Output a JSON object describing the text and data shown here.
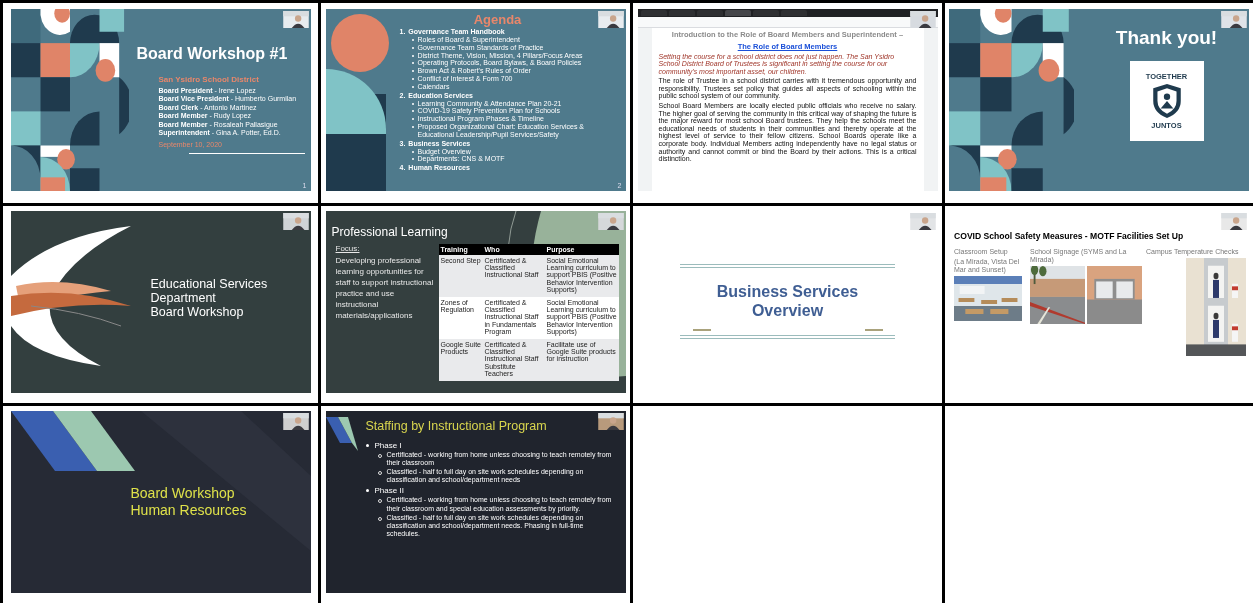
{
  "slides": [
    {
      "kind": "workshop",
      "title": "Board Workshop #1",
      "district": "San Ysidro School District",
      "members": [
        "**Board President** - Irene Lopez",
        "**Board Vice President** - Humberto Gurmilan",
        "**Board Clerk** - Antonio Martinez",
        "**Board Member** - Rudy Lopez",
        "**Board Member** - Rosaleah Pallasigue",
        "**Superintendent** - Gina A. Potter, Ed.D."
      ],
      "date": "September 10, 2020",
      "page": "1"
    },
    {
      "kind": "agenda",
      "title": "Agenda",
      "sections": [
        {
          "number": "1.",
          "heading": "Governance Team Handbook",
          "items": [
            "Roles of Board & Superintendent",
            "Governance Team Standards of Practice",
            "District Theme, Vision, Mission, 4 Pillars/Focus Areas",
            "Operating Protocols, Board Bylaws, & Board Policies",
            "Brown Act & Robert's Rules of Order",
            "Conflict of Interest & Form 700",
            "Calendars"
          ]
        },
        {
          "number": "2.",
          "heading": "Education Services",
          "items": [
            "Learning Community & Attendance Plan 20-21",
            "COVID-19 Safety Prevention Plan for Schools",
            "Instructional Program Phases & Timeline",
            "Proposed Organizational Chart: Education Services & Educational Leadership/Pupil Services/Safety"
          ]
        },
        {
          "number": "3.",
          "heading": "Business Services",
          "items": [
            "Budget Overview",
            "Departments: CNS & MOTF"
          ]
        },
        {
          "number": "4.",
          "heading": "Human Resources"
        }
      ],
      "page": "2"
    },
    {
      "kind": "document",
      "heading": "Introduction to the Role of Board Members and Superintendent –",
      "link": "The Role of Board Members",
      "quote": "Setting the course for a school district does not just happen. The San Ysidro School District Board of Trustees is significant in setting the course for our community's most important asset, our children.",
      "paragraphs": [
        "The role of Trustee in a school district carries with it tremendous opportunity and responsibility. Trustees set policy that guides all aspects of schooling within the public school system of our community.",
        "School Board Members are locally elected public officials who receive no salary. The higher goal of serving the community in this critical way of shaping the future is the major reward for most school Board trustees. They help the schools meet the educational needs of students in their communities and thereby operate at the highest level of service to their fellow citizens. School Boards operate like a corporate body. Individual Members acting independently have no legal status or authority and cannot commit or bind the Board by their actions. This is a critical distinction."
      ]
    },
    {
      "kind": "thanks",
      "title": "Thank you!",
      "logo_top": "TOGETHER",
      "logo_bottom": "JUNTOS"
    },
    {
      "kind": "swoosh",
      "lines": [
        "Educational Services",
        "Department",
        "Board Workshop"
      ]
    },
    {
      "kind": "table",
      "title": "Professional Learning",
      "focus_label": "Focus:",
      "focus_text": "Developing professional learning opportunities for staff to support instructional practice and use instructional materials/applications",
      "columns": [
        "Training",
        "Who",
        "Purpose"
      ],
      "rows": [
        [
          "Second Step",
          "Certificated & Classified Instructional Staff",
          "Social Emotional Learning curriculum to support PBIS (Positive Behavior Intervention Supports)"
        ],
        [
          "Zones of Regulation",
          "Certificated & Classified Instructional Staff in Fundamentals Program",
          "Social Emotional Learning curriculum to support PBIS (Positive Behavior Intervention Supports)"
        ],
        [
          "Google Suite Products",
          "Certificated & Classified Instructional Staff Substitute Teachers",
          "Facilitate use of Google Suite products for instruction"
        ]
      ]
    },
    {
      "kind": "banner",
      "lines": [
        "Business Services",
        "Overview"
      ]
    },
    {
      "kind": "photos",
      "title": "COVID School Safety Measures - MOTF Facilities Set Up",
      "groups": [
        {
          "caption": "Classroom Setup",
          "note": "(La Mirada, Vista Del Mar and Sunset)",
          "photos": [
            {
              "kind": "classroom"
            }
          ]
        },
        {
          "caption": "School Signage (SYMS and La Mirada)",
          "photos": [
            {
              "kind": "building"
            },
            {
              "kind": "doors"
            }
          ]
        },
        {
          "caption": "Campus Temperature Checks",
          "photos": [
            {
              "kind": "hallway"
            },
            {
              "kind": "hallway"
            }
          ]
        }
      ]
    },
    {
      "kind": "stripes",
      "lines": [
        "Board Workshop",
        "Human Resources"
      ]
    },
    {
      "kind": "bullets",
      "title": "Staffing by Instructional Program",
      "phases": [
        {
          "label": "Phase I",
          "items": [
            "Certificated - working from home unless choosing to teach remotely from their classroom",
            "Classified - half to full day on site work schedules depending on classification and school/department needs"
          ]
        },
        {
          "label": "Phase II",
          "items": [
            "Certificated - working from home unless choosing to teach remotely from their classroom and special education assessments by priority.",
            "Classified - half to full day on site work schedules depending on classification and school/department needs. Phasing in full-time schedules."
          ]
        }
      ]
    }
  ]
}
